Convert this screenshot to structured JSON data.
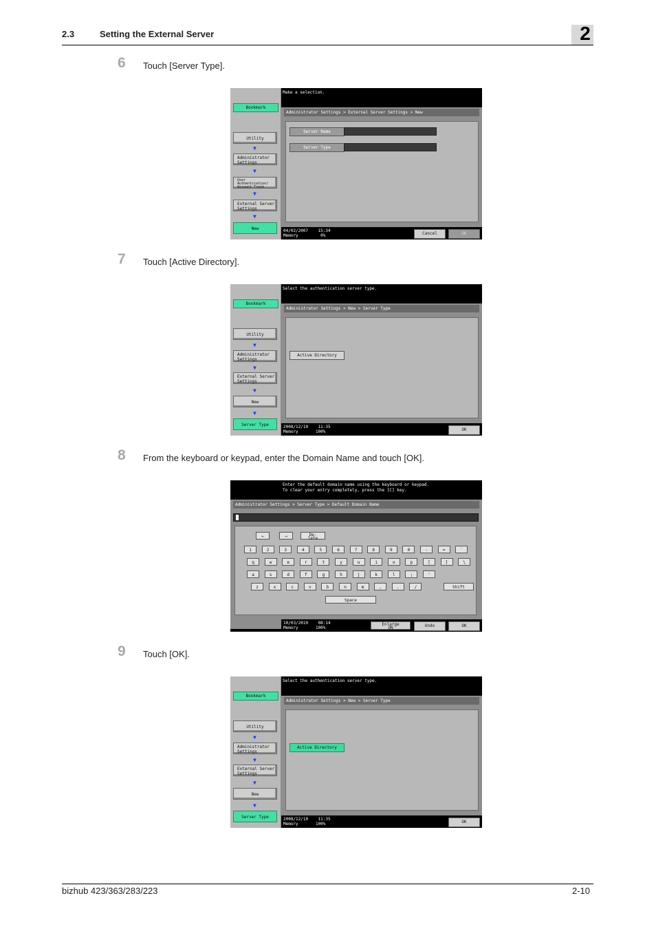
{
  "header": {
    "section": "2.3",
    "title": "Setting the External Server",
    "chapter": "2"
  },
  "steps": [
    {
      "number": "6",
      "text": "Touch [Server Type]."
    },
    {
      "number": "7",
      "text": "Touch [Active Directory]."
    },
    {
      "number": "8",
      "text": "From the keyboard or keypad, enter the Domain Name and touch [OK]."
    },
    {
      "number": "9",
      "text": "Touch [OK]."
    }
  ],
  "screen1": {
    "message": "Make a selection.",
    "bookmark": "Bookmark",
    "nav": [
      "Utility",
      "Administrator\nSettings",
      "User\nAuthentication/\nAccount Track",
      "External Server\nSettings",
      "New"
    ],
    "breadcrumb": "Administrator Settings > External Server Settings > New",
    "fields": [
      "Server Name",
      "Server Type"
    ],
    "status_date": "04/02/2007    15:34",
    "status_memory": "Memory         0%",
    "cancel": "Cancel",
    "ok": "OK"
  },
  "screen2": {
    "message": "Select the authentication server type.",
    "bookmark": "Bookmark",
    "nav": [
      "Utility",
      "Administrator\nSettings",
      "External Server\nSettings",
      "New",
      "Server Type"
    ],
    "breadcrumb": "Administrator Settings > New > Server Type",
    "option": "Active Directory",
    "status_date": "2008/12/10    11:35",
    "status_memory": "Memory       100%",
    "ok": "OK"
  },
  "screen3": {
    "message": "Enter the default domain name using the keyboard or keypad.\nTo clear your entry completely, press the [C] key.",
    "breadcrumb": "Administrator Settings > Server Type > Default Domain Name",
    "arrow_left": "←",
    "arrow_right": "→",
    "delete_key": "De-\nlete",
    "row1": [
      "1",
      "2",
      "3",
      "4",
      "5",
      "6",
      "7",
      "8",
      "9",
      "0",
      "-",
      "=",
      "`"
    ],
    "row2": [
      "q",
      "w",
      "e",
      "r",
      "t",
      "y",
      "u",
      "i",
      "o",
      "p",
      "[",
      "]",
      "\\"
    ],
    "row3": [
      "a",
      "s",
      "d",
      "f",
      "g",
      "h",
      "j",
      "k",
      "l",
      ";",
      "'"
    ],
    "row4": [
      "z",
      "x",
      "c",
      "v",
      "b",
      "n",
      "m",
      ",",
      ".",
      "/"
    ],
    "shift": "Shift",
    "space": "Space",
    "status_date": "10/03/2010    08:14",
    "status_memory": "Memory       100%",
    "enlarge": "Enlarge\nON",
    "undo": "Undo",
    "ok": "OK"
  },
  "screen4": {
    "message": "Select the authentication server type.",
    "bookmark": "Bookmark",
    "nav": [
      "Utility",
      "Administrator\nSettings",
      "External Server\nSettings",
      "New",
      "Server Type"
    ],
    "breadcrumb": "Administrator Settings > New > Server Type",
    "option": "Active Directory",
    "status_date": "2008/12/10    11:35",
    "status_memory": "Memory       100%",
    "ok": "OK"
  },
  "footer": {
    "model": "bizhub 423/363/283/223",
    "page": "2-10"
  },
  "colors": {
    "accent_green": "#43e0a4",
    "arrow_blue": "#1a3cff",
    "panel_gray": "#b8b8b8"
  }
}
